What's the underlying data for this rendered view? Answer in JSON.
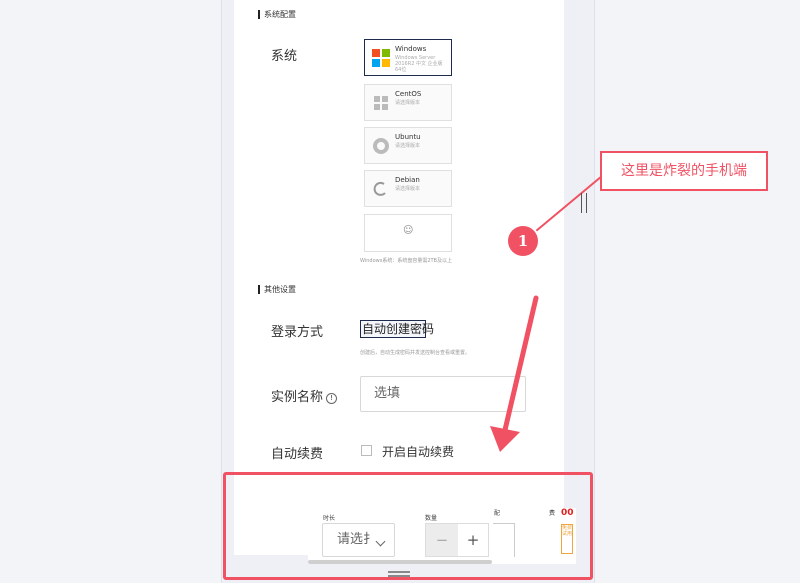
{
  "sections": {
    "system_config": "系统配置",
    "other_settings": "其他设置"
  },
  "labels": {
    "system": "系统",
    "login_method": "登录方式",
    "instance_name": "实例名称",
    "auto_renew": "自动续费"
  },
  "os_options": [
    {
      "name": "Windows",
      "desc": "Windows Server 2016R2 中文 企业版 64位",
      "selected": true
    },
    {
      "name": "CentOS",
      "desc": "请选择版本",
      "selected": false
    },
    {
      "name": "Ubuntu",
      "desc": "请选择版本",
      "selected": false
    },
    {
      "name": "Debian",
      "desc": "请选择版本",
      "selected": false
    }
  ],
  "os_more_symbol": "☺",
  "os_hint": "Windows系统：系统盘容量需2TB及以上",
  "login": {
    "button": "自动创建密码",
    "hint": "创建后，自动生成密码并发送控制台查看或重置。"
  },
  "instance_name_placeholder": "选填",
  "info_symbol": "!",
  "auto_renew_label": "开启自动续费",
  "mobile_bar": {
    "duration_label": "时长",
    "duration_placeholder": "请选扌",
    "quantity_label": "数量",
    "minus": "−",
    "plus": "+",
    "col3_label": "配",
    "col4_label": "费",
    "price_fragment": "00",
    "tag": "免费试用"
  },
  "annotation": {
    "callout": "这里是炸裂的手机端",
    "badge": "1"
  },
  "colors": {
    "accent": "#f05263",
    "selected_border": "#1f2b4d"
  }
}
